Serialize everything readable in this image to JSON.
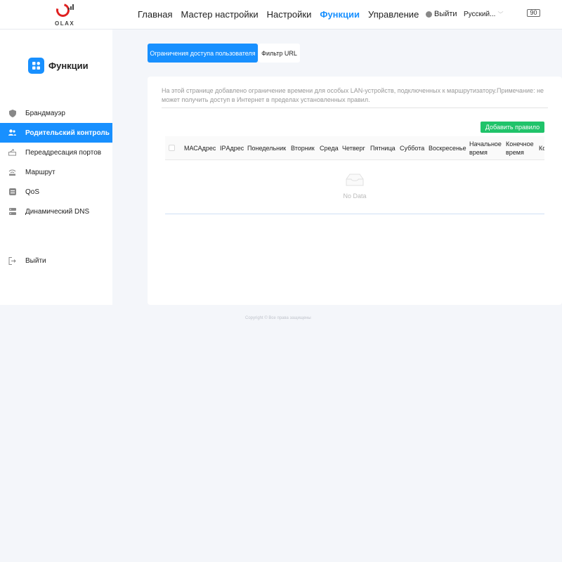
{
  "header": {
    "logo_text": "OLAX",
    "nav": [
      "Главная",
      "Мастер настройки",
      "Настройки",
      "Функции",
      "Управление"
    ],
    "active_nav": "Функции",
    "logout": "Выйти",
    "language": "Русский...",
    "battery": "90"
  },
  "sidebar": {
    "title": "Функции",
    "items": [
      {
        "label": "Брандмауэр",
        "icon": "shield-icon"
      },
      {
        "label": "Родительский контроль",
        "icon": "users-icon",
        "active": true
      },
      {
        "label": "Переадресация портов",
        "icon": "port-forward-icon"
      },
      {
        "label": "Маршрут",
        "icon": "route-icon"
      },
      {
        "label": "QoS",
        "icon": "qos-icon"
      },
      {
        "label": "Динамический DNS",
        "icon": "dns-icon"
      }
    ],
    "logout": "Выйти"
  },
  "tabs": [
    "Ограничения доступа пользователя",
    "Фильтр URL"
  ],
  "content": {
    "description": "На этой странице добавлено ограничение времени для особых LAN-устройств, подключенных к маршрутизатору.Примечание: не может получить доступ в Интернет в пределах установленных правил.",
    "add_button": "Добавить правило",
    "columns": [
      "МАСАдрес",
      "IPАдрес",
      "Понедельник",
      "Вторник",
      "Среда",
      "Четверг",
      "Пятница",
      "Суббота",
      "Воскресенье",
      "Начальное время",
      "Конечное время",
      "Ко"
    ],
    "empty_text": "No Data"
  },
  "footer": "Copyright © Все права защищены",
  "colors": {
    "accent": "#1890ff",
    "add_button": "#20c36a",
    "logo": "#e02020"
  }
}
